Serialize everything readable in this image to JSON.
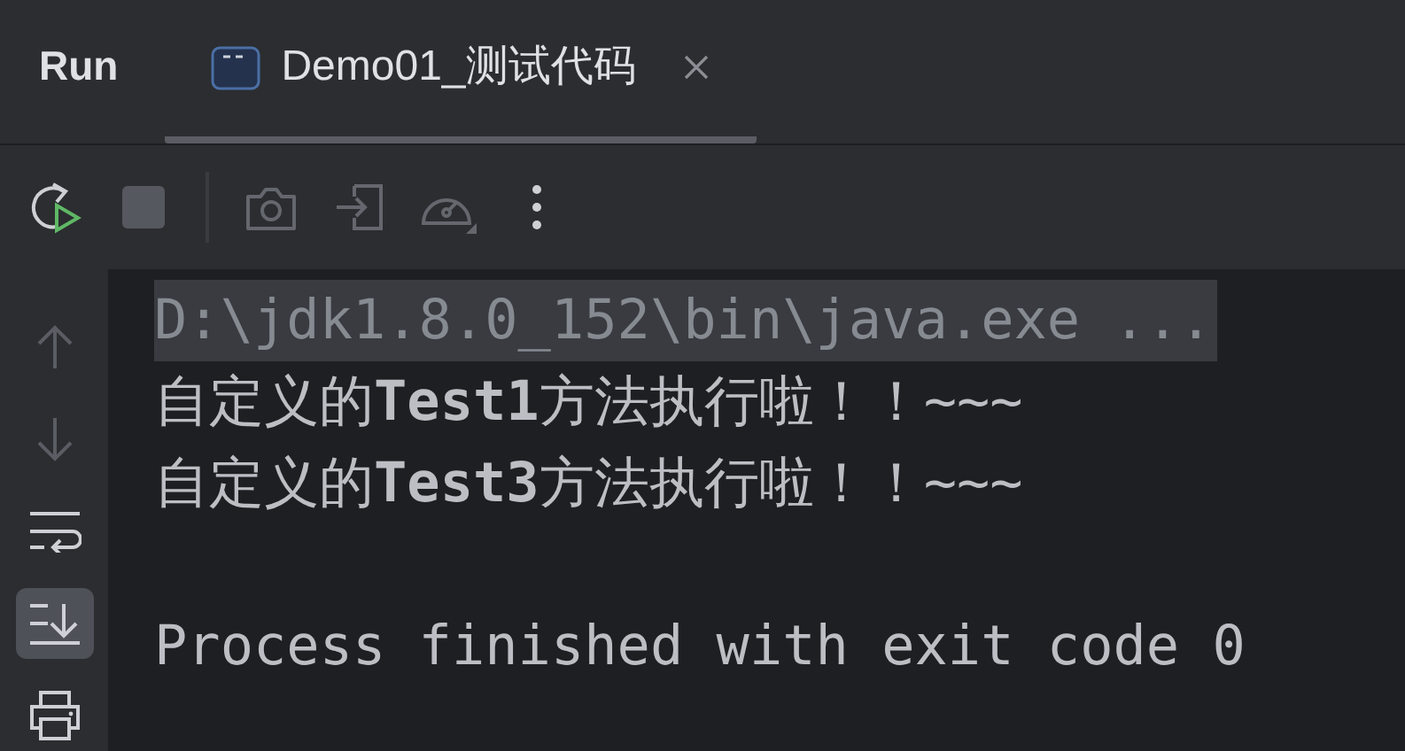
{
  "panel": {
    "title": "Run"
  },
  "tabs": [
    {
      "label": "Demo01_测试代码",
      "selected": true
    }
  ],
  "toolbar": [
    {
      "kind": "rerun",
      "disabled": false
    },
    {
      "kind": "stop",
      "disabled": true
    },
    {
      "kind": "camera",
      "disabled": true
    },
    {
      "kind": "enter",
      "disabled": true
    },
    {
      "kind": "gauge",
      "disabled": true
    },
    {
      "kind": "more",
      "disabled": false
    }
  ],
  "side_actions": [
    {
      "kind": "up",
      "disabled": true,
      "on": false
    },
    {
      "kind": "down",
      "disabled": true,
      "on": false
    },
    {
      "kind": "wrap",
      "disabled": false,
      "on": false
    },
    {
      "kind": "scroll-end",
      "disabled": false,
      "on": true
    },
    {
      "kind": "print",
      "disabled": false,
      "on": false
    }
  ],
  "console": [
    {
      "kind": "command",
      "text": "D:\\jdk1.8.0_152\\bin\\java.exe ..."
    },
    {
      "kind": "output",
      "text": "自定义的**Test1**方法执行啦！！~~~"
    },
    {
      "kind": "output",
      "text": "自定义的**Test3**方法执行啦！！~~~"
    },
    {
      "kind": "status",
      "text": "Process finished with exit code 0"
    }
  ]
}
